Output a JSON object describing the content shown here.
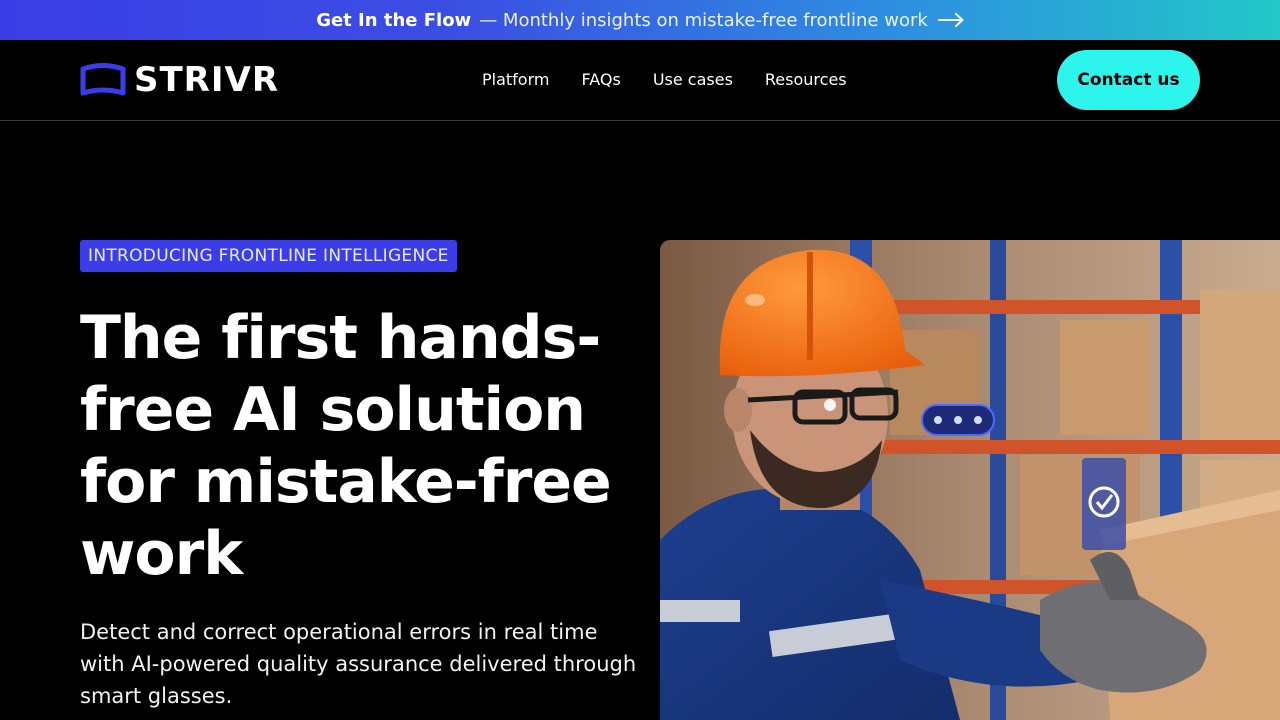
{
  "announcement": {
    "bold": "Get In the Flow",
    "text": "— Monthly insights on mistake-free frontline work",
    "arrow_icon": "arrow-right-icon"
  },
  "nav": {
    "logo_text": "STRIVR",
    "items": [
      {
        "label": "Platform"
      },
      {
        "label": "FAQs"
      },
      {
        "label": "Use cases"
      },
      {
        "label": "Resources"
      }
    ],
    "contact_label": "Contact us"
  },
  "hero": {
    "badge": "INTRODUCING FRONTLINE INTELLIGENCE",
    "headline": "The first hands-free AI solution for mistake-free work",
    "subtext": "Detect and correct operational errors in real time with AI-powered quality assurance delivered through smart glasses."
  },
  "colors": {
    "accent_blue": "#3b3ee8",
    "contact_cyan": "#2df5ec",
    "background": "#000000"
  }
}
